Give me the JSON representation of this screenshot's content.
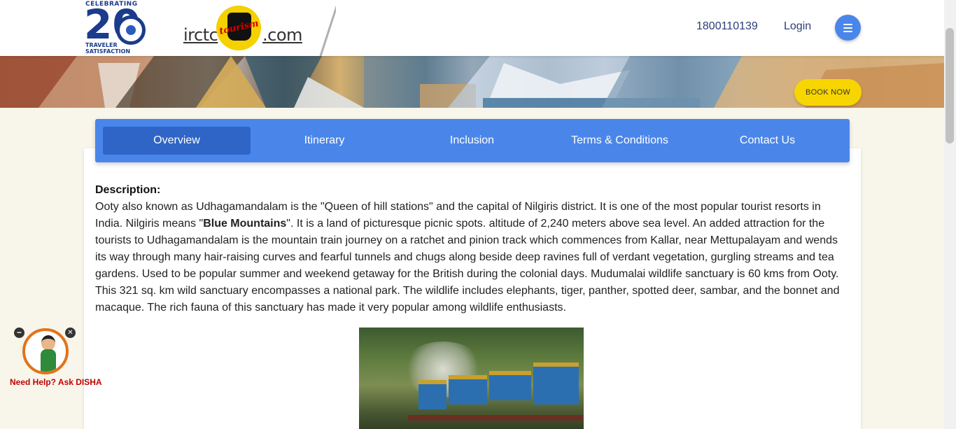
{
  "header": {
    "badge": {
      "top_text": "CELEBRATING",
      "number": "20",
      "bottom_text_1": "TRAVELER",
      "bottom_text_2": "SATISFACTION"
    },
    "logo": {
      "left_text": "irctc",
      "emblem_text": "tourism",
      "right_text": ".com"
    },
    "phone": "1800110139",
    "login_label": "Login",
    "menu_icon": "hamburger-menu-icon"
  },
  "banner": {
    "book_now_label": "BOOK NOW"
  },
  "tabs": [
    {
      "label": "Overview",
      "active": true
    },
    {
      "label": "Itinerary",
      "active": false
    },
    {
      "label": "Inclusion",
      "active": false
    },
    {
      "label": "Terms & Conditions",
      "active": false
    },
    {
      "label": "Contact Us",
      "active": false
    }
  ],
  "description": {
    "title": "Description:",
    "part1": "Ooty also known as Udhagamandalam is the \"Queen of hill stations\" and the capital of Nilgiris district. It is one of the most popular tourist resorts in India. Nilgiris means \"",
    "bold": "Blue Mountains",
    "part2": "\". It is a land of picturesque picnic spots. altitude of 2,240 meters above sea level. An added attraction for the tourists to Udhagamandalam is the mountain train journey on a ratchet and pinion track which commences from Kallar, near Mettupalayam and wends its way through many hair-raising curves and fearful tunnels and chugs along beside deep ravines full of verdant vegetation, gurgling streams and tea gardens. Used to be popular summer and weekend getaway for the British during the colonial days. Mudumalai wildlife sanctuary is 60 kms from Ooty. This 321 sq. km wild sanctuary encompasses a national park. The wildlife includes elephants, tiger, panther, spotted deer, sambar, and the bonnet and macaque. The rich fauna of this sanctuary has made it very popular among wildlife enthusiasts."
  },
  "help_widget": {
    "label": "Need Help? Ask DISHA",
    "minimize_icon": "minus-icon",
    "close_icon": "close-icon",
    "minimize_glyph": "−",
    "close_glyph": "✕"
  },
  "colors": {
    "accent_blue": "#4a86ea",
    "active_tab": "#2f65c7",
    "book_now_yellow": "#f7d500",
    "page_background": "#f8f5ea",
    "help_label_red": "#c00000"
  }
}
